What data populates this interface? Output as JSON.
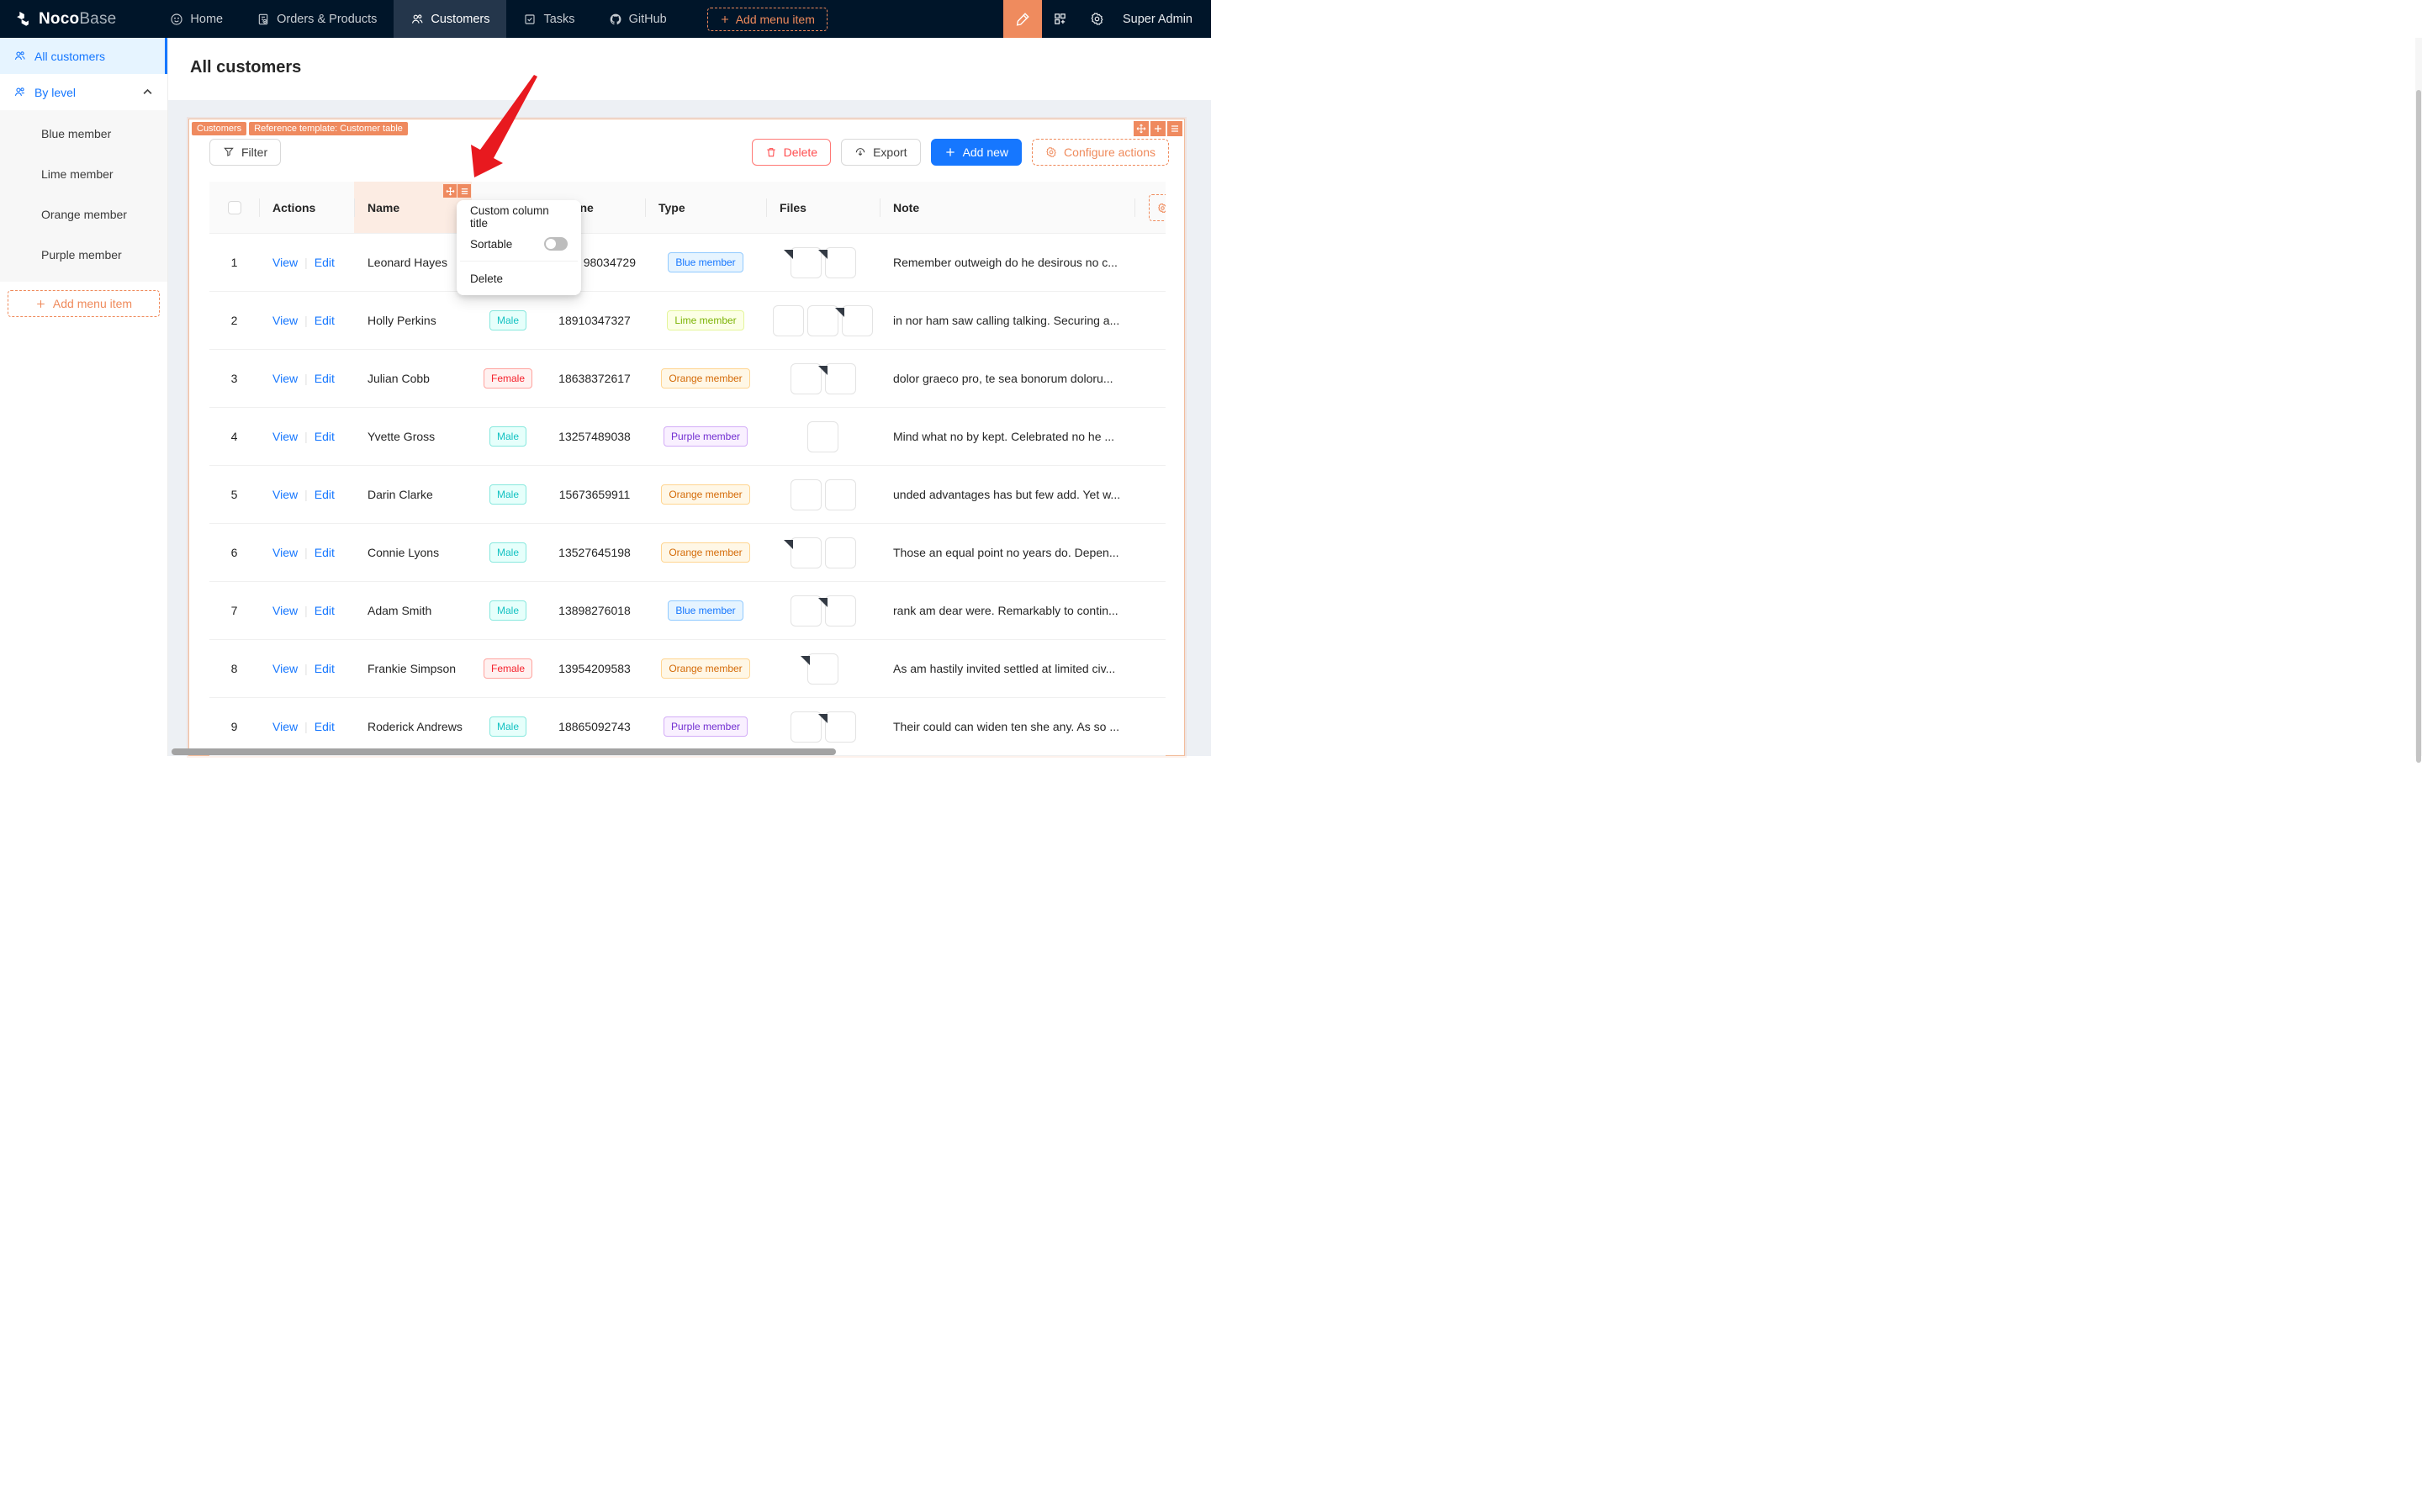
{
  "navbar": {
    "brand_bold": "Noco",
    "brand_light": "Base",
    "items": [
      {
        "label": "Home",
        "icon": "smiley-icon",
        "active": false
      },
      {
        "label": "Orders & Products",
        "icon": "orders-icon",
        "active": false
      },
      {
        "label": "Customers",
        "icon": "customers-icon",
        "active": true
      },
      {
        "label": "Tasks",
        "icon": "tasks-icon",
        "active": false
      },
      {
        "label": "GitHub",
        "icon": "github-icon",
        "active": false
      }
    ],
    "add_menu_item": "Add menu item",
    "user": "Super Admin"
  },
  "sidebar": {
    "items": [
      {
        "label": "All customers",
        "selected": true
      },
      {
        "label": "By level",
        "expanded": true
      }
    ],
    "sub_items": [
      {
        "label": "Blue member"
      },
      {
        "label": "Lime member"
      },
      {
        "label": "Orange member"
      },
      {
        "label": "Purple member"
      }
    ],
    "add_menu_item": "Add menu item"
  },
  "page": {
    "title": "All customers"
  },
  "block": {
    "tags": [
      "Customers",
      "Reference template: Customer table"
    ],
    "toolbar": {
      "filter": "Filter",
      "delete": "Delete",
      "export": "Export",
      "add_new": "Add new",
      "configure_actions": "Configure actions"
    }
  },
  "dropdown": {
    "custom_title": "Custom column title",
    "sortable": "Sortable",
    "sortable_enabled": false,
    "delete": "Delete"
  },
  "table": {
    "headers": {
      "actions": "Actions",
      "name": "Name",
      "gender": "",
      "phone": "Phone",
      "type": "Type",
      "files": "Files",
      "note": "Note"
    },
    "links": {
      "view": "View",
      "edit": "Edit"
    },
    "rows": [
      {
        "index": "1",
        "name": "Leonard Hayes",
        "gender": null,
        "phone": "98034729",
        "type": "Blue member",
        "files": [
          "pdf",
          "doc"
        ],
        "note": "Remember outweigh do he desirous no c..."
      },
      {
        "index": "2",
        "name": "Holly Perkins",
        "gender": "Male",
        "phone": "18910347327",
        "type": "Lime member",
        "files": [
          "img-oranges",
          "img-berries",
          "doc"
        ],
        "note": "in nor ham saw calling talking. Securing a..."
      },
      {
        "index": "3",
        "name": "Julian Cobb",
        "gender": "Female",
        "phone": "18638372617",
        "type": "Orange member",
        "files": [
          "img-food",
          "pdf"
        ],
        "note": "dolor graeco pro, te sea bonorum doloru..."
      },
      {
        "index": "4",
        "name": "Yvette Gross",
        "gender": "Male",
        "phone": "13257489038",
        "type": "Purple member",
        "files": [
          "img-cookies"
        ],
        "note": "Mind what no by kept. Celebrated no he ..."
      },
      {
        "index": "5",
        "name": "Darin Clarke",
        "gender": "Male",
        "phone": "15673659911",
        "type": "Orange member",
        "files": [
          "img-oranges",
          "img-cookies"
        ],
        "note": "unded advantages has but few add. Yet w..."
      },
      {
        "index": "6",
        "name": "Connie Lyons",
        "gender": "Male",
        "phone": "13527645198",
        "type": "Orange member",
        "files": [
          "pdf",
          "img-orange-fruit"
        ],
        "note": "Those an equal point no years do. Depen..."
      },
      {
        "index": "7",
        "name": "Adam Smith",
        "gender": "Male",
        "phone": "13898276018",
        "type": "Blue member",
        "files": [
          "img-coffee",
          "pdf"
        ],
        "note": "rank am dear were. Remarkably to contin..."
      },
      {
        "index": "8",
        "name": "Frankie Simpson",
        "gender": "Female",
        "phone": "13954209583",
        "type": "Orange member",
        "files": [
          "pdf"
        ],
        "note": "As am hastily invited settled at limited civ..."
      },
      {
        "index": "9",
        "name": "Roderick Andrews",
        "gender": "Male",
        "phone": "18865092743",
        "type": "Purple member",
        "files": [
          "img-storefront",
          "doc"
        ],
        "note": "Their could can widen ten she any. As so ..."
      }
    ]
  },
  "colors": {
    "primary_blue": "#1677ff",
    "salmon_accent": "#ef8a5f",
    "navbar_bg": "#001529",
    "danger_red": "#ff4d4f",
    "annotation_arrow": "#e8191f",
    "card_border": "#f2bd9c"
  }
}
